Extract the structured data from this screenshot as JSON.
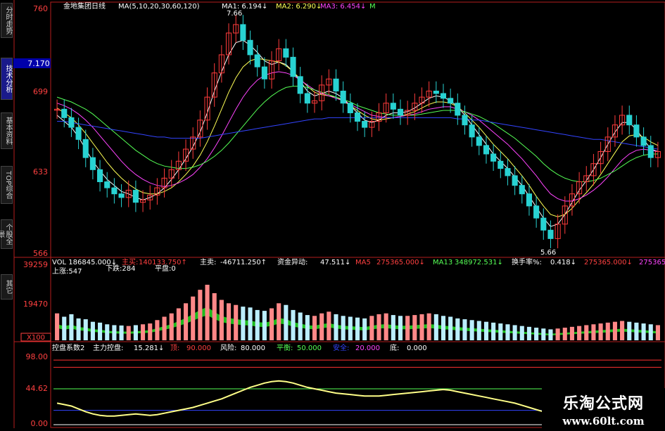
{
  "side_tabs": [
    "分时走势",
    "技术分析",
    "基本资料",
    "TOP综合",
    "个股全景",
    "其它"
  ],
  "main": {
    "title": "金地集团日线",
    "ma_params": "MA(5,10,20,30,60,120)",
    "ma1": "MA1: 6.194↓",
    "ma2": "MA2: 6.290↓",
    "ma3": "MA3: 6.454↓",
    "ma4": "M",
    "y_ticks": [
      "760",
      "699",
      "633",
      "566"
    ],
    "cur_price": "7.170",
    "hi_label": "7.66",
    "lo_label": "5.66"
  },
  "vol": {
    "row1": [
      "VOL 186845.000↓",
      "主买:",
      "140133.750↑",
      "主卖:",
      "-46711.250↑",
      "资金异动:",
      "47.511↓",
      "MA5",
      "275365.000↓",
      "MA13",
      "348972.531↓",
      "换手率%:",
      "0.418↓",
      "275365.000↓",
      "275365"
    ],
    "row2": [
      "上涨:547",
      "下跌:284",
      "平盘:0"
    ],
    "y_ticks": [
      "39259",
      "19470",
      "X100"
    ]
  },
  "ind": {
    "row1": [
      "控盘系数2",
      "主力控盘:",
      "15.281↓",
      "顶:",
      "90.000",
      "风险:",
      "80.000",
      "平衡:",
      "50.000",
      "安全:",
      "20.000",
      "底:",
      "0.000"
    ],
    "y_ticks": [
      "98.00",
      "44.62",
      "0.00"
    ]
  },
  "colors": {
    "up": "#ff3c3c",
    "down": "#28d2d2",
    "ma1": "#ffffff",
    "ma2": "#ffff55",
    "ma3": "#ff44ff",
    "ma4": "#55ff55",
    "ma5": "#3344ff",
    "ind_line": "#ffff88",
    "green_band": "#22dd22",
    "red_band": "#ff2222",
    "axis": "#b41e1e"
  },
  "chart_data": {
    "type": "candlestick",
    "title": "金地集团日线",
    "ylim": [
      5.66,
      7.66
    ],
    "y_tick_labels": [
      "760",
      "699",
      "633",
      "566"
    ],
    "series": [
      {
        "name": "close",
        "values": [
          6.85,
          6.78,
          6.7,
          6.6,
          6.45,
          6.35,
          6.25,
          6.2,
          6.15,
          6.12,
          6.18,
          6.08,
          6.1,
          6.14,
          6.2,
          6.28,
          6.35,
          6.42,
          6.52,
          6.62,
          6.76,
          6.95,
          7.15,
          7.3,
          7.48,
          7.55,
          7.42,
          7.3,
          7.2,
          7.1,
          7.25,
          7.35,
          7.28,
          7.12,
          6.98,
          6.9,
          6.92,
          7.05,
          7.1,
          7.0,
          6.9,
          6.82,
          6.75,
          6.7,
          6.75,
          6.82,
          6.9,
          6.85,
          6.8,
          6.84,
          6.9,
          6.95,
          7.0,
          6.98,
          6.94,
          6.9,
          6.8,
          6.72,
          6.62,
          6.55,
          6.48,
          6.42,
          6.36,
          6.3,
          6.22,
          6.15,
          6.05,
          5.95,
          5.85,
          5.78,
          5.9,
          6.05,
          6.15,
          6.25,
          6.3,
          6.4,
          6.5,
          6.62,
          6.72,
          6.8,
          6.72,
          6.62,
          6.55,
          6.45,
          6.5
        ]
      },
      {
        "name": "MA1",
        "values": [
          6.8,
          6.75,
          6.7,
          6.62,
          6.52,
          6.42,
          6.34,
          6.27,
          6.22,
          6.17,
          6.15,
          6.12,
          6.1,
          6.12,
          6.15,
          6.2,
          6.27,
          6.35,
          6.44,
          6.54,
          6.66,
          6.82,
          7.0,
          7.16,
          7.3,
          7.4,
          7.42,
          7.38,
          7.32,
          7.25,
          7.22,
          7.24,
          7.22,
          7.16,
          7.08,
          7.0,
          6.96,
          6.98,
          7.0,
          6.98,
          6.94,
          6.88,
          6.82,
          6.76,
          6.74,
          6.76,
          6.8,
          6.82,
          6.82,
          6.83,
          6.86,
          6.9,
          6.94,
          6.96,
          6.95,
          6.92,
          6.87,
          6.8,
          6.72,
          6.64,
          6.56,
          6.48,
          6.42,
          6.36,
          6.29,
          6.22,
          6.13,
          6.04,
          5.95,
          5.88,
          5.9,
          5.98,
          6.08,
          6.18,
          6.26,
          6.35,
          6.45,
          6.56,
          6.66,
          6.74,
          6.74,
          6.68,
          6.6,
          6.52,
          6.5
        ]
      },
      {
        "name": "MA2",
        "values": [
          6.86,
          6.82,
          6.78,
          6.72,
          6.65,
          6.57,
          6.49,
          6.41,
          6.34,
          6.28,
          6.23,
          6.19,
          6.16,
          6.15,
          6.15,
          6.17,
          6.2,
          6.25,
          6.31,
          6.38,
          6.47,
          6.58,
          6.71,
          6.85,
          6.99,
          7.11,
          7.2,
          7.25,
          7.27,
          7.26,
          7.25,
          7.24,
          7.21,
          7.16,
          7.1,
          7.04,
          6.99,
          6.97,
          6.96,
          6.95,
          6.92,
          6.88,
          6.84,
          6.8,
          6.77,
          6.76,
          6.77,
          6.78,
          6.79,
          6.81,
          6.83,
          6.86,
          6.89,
          6.91,
          6.91,
          6.9,
          6.87,
          6.82,
          6.76,
          6.7,
          6.63,
          6.56,
          6.5,
          6.44,
          6.37,
          6.3,
          6.22,
          6.13,
          6.05,
          5.98,
          5.96,
          5.98,
          6.03,
          6.1,
          6.16,
          6.23,
          6.31,
          6.4,
          6.49,
          6.58,
          6.63,
          6.64,
          6.62,
          6.58,
          6.55
        ]
      },
      {
        "name": "MA3",
        "values": [
          6.9,
          6.88,
          6.85,
          6.81,
          6.76,
          6.7,
          6.63,
          6.56,
          6.49,
          6.42,
          6.36,
          6.31,
          6.27,
          6.24,
          6.22,
          6.21,
          6.22,
          6.24,
          6.27,
          6.31,
          6.37,
          6.44,
          6.53,
          6.63,
          6.74,
          6.85,
          6.95,
          7.03,
          7.09,
          7.13,
          7.15,
          7.16,
          7.15,
          7.13,
          7.09,
          7.05,
          7.01,
          6.98,
          6.96,
          6.94,
          6.92,
          6.89,
          6.86,
          6.83,
          6.8,
          6.79,
          6.78,
          6.78,
          6.79,
          6.8,
          6.81,
          6.83,
          6.85,
          6.86,
          6.87,
          6.87,
          6.85,
          6.83,
          6.8,
          6.76,
          6.71,
          6.66,
          6.61,
          6.56,
          6.5,
          6.44,
          6.37,
          6.3,
          6.22,
          6.15,
          6.11,
          6.09,
          6.09,
          6.11,
          6.14,
          6.18,
          6.23,
          6.29,
          6.36,
          6.43,
          6.48,
          6.51,
          6.52,
          6.51,
          6.5
        ]
      },
      {
        "name": "MA4",
        "values": [
          6.95,
          6.93,
          6.91,
          6.88,
          6.85,
          6.81,
          6.76,
          6.71,
          6.66,
          6.61,
          6.56,
          6.51,
          6.47,
          6.43,
          6.4,
          6.38,
          6.37,
          6.36,
          6.36,
          6.37,
          6.39,
          6.42,
          6.46,
          6.51,
          6.57,
          6.64,
          6.71,
          6.78,
          6.85,
          6.91,
          6.96,
          7.0,
          7.03,
          7.04,
          7.04,
          7.03,
          7.01,
          6.99,
          6.97,
          6.95,
          6.93,
          6.91,
          6.88,
          6.86,
          6.84,
          6.82,
          6.81,
          6.8,
          6.8,
          6.8,
          6.8,
          6.81,
          6.82,
          6.83,
          6.84,
          6.84,
          6.84,
          6.83,
          6.81,
          6.79,
          6.76,
          6.73,
          6.69,
          6.65,
          6.61,
          6.56,
          6.51,
          6.46,
          6.4,
          6.35,
          6.31,
          6.28,
          6.26,
          6.25,
          6.25,
          6.26,
          6.28,
          6.31,
          6.34,
          6.38,
          6.42,
          6.45,
          6.47,
          6.48,
          6.48
        ]
      },
      {
        "name": "MA5",
        "values": [
          6.75,
          6.75,
          6.74,
          6.73,
          6.72,
          6.71,
          6.7,
          6.69,
          6.68,
          6.67,
          6.66,
          6.65,
          6.64,
          6.63,
          6.62,
          6.62,
          6.61,
          6.61,
          6.61,
          6.61,
          6.61,
          6.62,
          6.63,
          6.64,
          6.65,
          6.66,
          6.67,
          6.68,
          6.69,
          6.7,
          6.71,
          6.72,
          6.73,
          6.74,
          6.75,
          6.76,
          6.77,
          6.77,
          6.78,
          6.78,
          6.78,
          6.78,
          6.78,
          6.78,
          6.78,
          6.78,
          6.78,
          6.78,
          6.78,
          6.78,
          6.78,
          6.78,
          6.78,
          6.78,
          6.78,
          6.78,
          6.77,
          6.77,
          6.76,
          6.76,
          6.75,
          6.74,
          6.73,
          6.72,
          6.71,
          6.7,
          6.69,
          6.68,
          6.67,
          6.66,
          6.65,
          6.64,
          6.63,
          6.62,
          6.61,
          6.6,
          6.6,
          6.59,
          6.58,
          6.57,
          6.56,
          6.55,
          6.54,
          6.53,
          6.52
        ]
      }
    ],
    "volume": {
      "ylim": [
        0,
        39259
      ],
      "values": [
        16000,
        14000,
        15500,
        13000,
        12500,
        11000,
        10500,
        9500,
        9000,
        8800,
        8500,
        9000,
        9500,
        10000,
        12000,
        14000,
        16000,
        19000,
        22000,
        26000,
        30000,
        33000,
        28000,
        24000,
        22000,
        21000,
        20000,
        19500,
        18000,
        17500,
        19000,
        22000,
        21000,
        18000,
        16500,
        15000,
        14500,
        16000,
        17000,
        15500,
        14500,
        14000,
        13500,
        13000,
        14500,
        15500,
        16000,
        15000,
        14500,
        14500,
        15000,
        15500,
        16000,
        15500,
        14500,
        14000,
        13000,
        12500,
        12000,
        11500,
        11000,
        10500,
        10000,
        9500,
        9000,
        8500,
        8000,
        7500,
        7000,
        6500,
        7000,
        7500,
        8000,
        8500,
        9000,
        9500,
        10000,
        10500,
        11000,
        11500,
        11000,
        10500,
        10000,
        9500,
        9000
      ]
    },
    "indicator": {
      "name": "主力控盘",
      "ylim": [
        0,
        98
      ],
      "levels": [
        90,
        80,
        50,
        20,
        0
      ],
      "values": [
        30,
        28,
        26,
        22,
        18,
        15,
        13,
        12,
        12,
        13,
        14,
        15,
        14,
        13,
        14,
        16,
        18,
        20,
        22,
        24,
        27,
        30,
        33,
        36,
        40,
        44,
        48,
        52,
        55,
        58,
        60,
        61,
        60,
        58,
        55,
        52,
        50,
        48,
        46,
        44,
        43,
        42,
        41,
        40,
        40,
        40,
        41,
        42,
        43,
        44,
        45,
        46,
        47,
        48,
        49,
        48,
        46,
        44,
        42,
        40,
        38,
        36,
        34,
        32,
        30,
        27,
        24,
        21,
        18,
        15,
        14,
        12,
        11,
        10,
        10,
        9,
        9,
        8,
        8,
        8,
        7,
        7,
        6,
        6,
        6
      ]
    }
  }
}
